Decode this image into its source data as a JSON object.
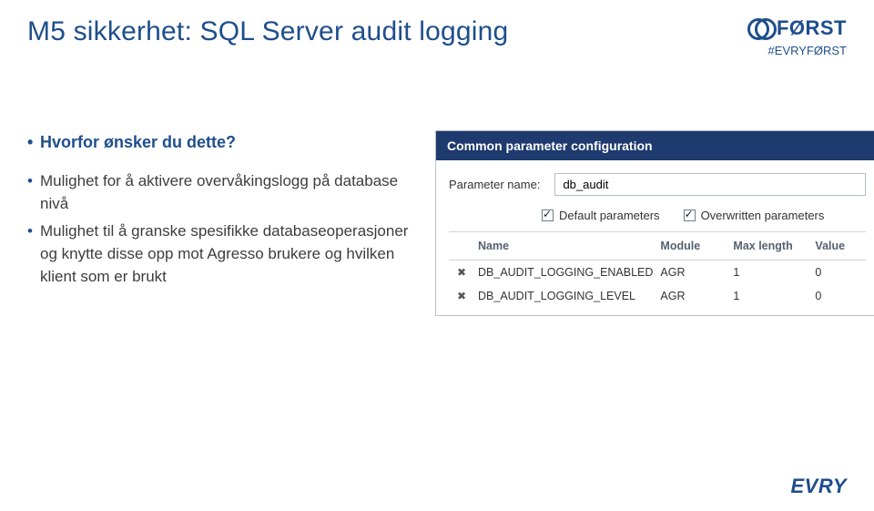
{
  "header": {
    "title": "M5 sikkerhet:  SQL Server audit logging",
    "brand_text": "FØRST",
    "hashtag": "#EVRYFØRST"
  },
  "bullets": {
    "question": "Hvorfor ønsker du dette?",
    "items": [
      "Mulighet for å aktivere overvåkingslogg på database nivå",
      "Mulighet til å granske spesifikke databaseoperasjoner og knytte disse opp mot Agresso brukere og hvilken klient som er brukt"
    ]
  },
  "panel": {
    "title": "Common parameter configuration",
    "param_label": "Parameter name:",
    "param_value": "db_audit",
    "chk_default": "Default parameters",
    "chk_overwritten": "Overwritten parameters",
    "columns": {
      "name": "Name",
      "module": "Module",
      "maxlen": "Max length",
      "value": "Value"
    },
    "rows": [
      {
        "name": "DB_AUDIT_LOGGING_ENABLED",
        "module": "AGR",
        "maxlen": "1",
        "value": "0"
      },
      {
        "name": "DB_AUDIT_LOGGING_LEVEL",
        "module": "AGR",
        "maxlen": "1",
        "value": "0"
      }
    ]
  },
  "footer": {
    "logo_text": "EVRY"
  }
}
